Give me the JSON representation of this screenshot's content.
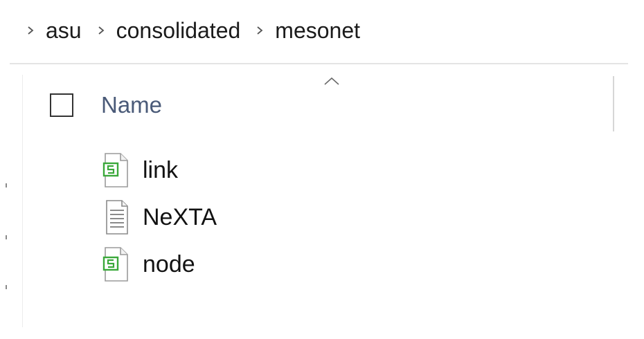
{
  "breadcrumb": {
    "items": [
      {
        "label": "asu"
      },
      {
        "label": "consolidated"
      },
      {
        "label": "mesonet"
      }
    ]
  },
  "header": {
    "name_column": "Name",
    "sort": "ascending"
  },
  "files": [
    {
      "name": "link",
      "icon": "spreadsheet-file-icon",
      "accent": "#3aa83a"
    },
    {
      "name": "NeXTA",
      "icon": "text-file-icon"
    },
    {
      "name": "node",
      "icon": "spreadsheet-file-icon",
      "accent": "#3aa83a"
    }
  ]
}
